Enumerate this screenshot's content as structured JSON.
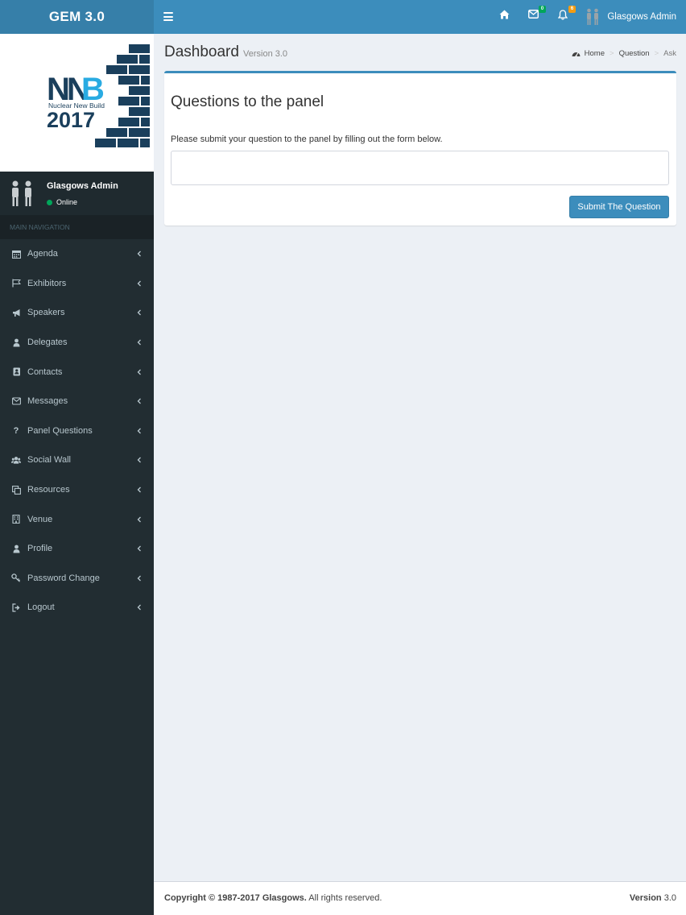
{
  "header": {
    "brand": "GEM 3.0",
    "messages_count": "0",
    "notifications_count": "6",
    "user_name": "Glasgows Admin"
  },
  "sidebar": {
    "logo_text_top": "NNB",
    "logo_tagline": "Nuclear New Build",
    "logo_year": "2017",
    "user_name": "Glasgows Admin",
    "user_status": "Online",
    "nav_header": "MAIN NAVIGATION",
    "items": [
      {
        "label": "Agenda",
        "icon": "calendar-icon"
      },
      {
        "label": "Exhibitors",
        "icon": "flag-icon"
      },
      {
        "label": "Speakers",
        "icon": "bullhorn-icon"
      },
      {
        "label": "Delegates",
        "icon": "user-icon"
      },
      {
        "label": "Contacts",
        "icon": "address-book-icon"
      },
      {
        "label": "Messages",
        "icon": "envelope-icon"
      },
      {
        "label": "Panel Questions",
        "icon": "question-icon"
      },
      {
        "label": "Social Wall",
        "icon": "users-icon"
      },
      {
        "label": "Resources",
        "icon": "clone-icon"
      },
      {
        "label": "Venue",
        "icon": "building-icon"
      },
      {
        "label": "Profile",
        "icon": "user-icon"
      },
      {
        "label": "Password Change",
        "icon": "key-icon"
      },
      {
        "label": "Logout",
        "icon": "sign-out-icon"
      }
    ]
  },
  "content_header": {
    "title": "Dashboard",
    "subtitle": "Version 3.0",
    "breadcrumb": [
      "Home",
      "Question",
      "Ask"
    ]
  },
  "box": {
    "title": "Questions to the panel",
    "description": "Please submit your question to the panel by filling out the form below.",
    "input_value": "",
    "submit_label": "Submit The Question"
  },
  "footer": {
    "copyright_bold": "Copyright © 1987-2017 Glasgows.",
    "copyright_rest": " All rights reserved.",
    "version_label": "Version",
    "version_value": " 3.0"
  },
  "colors": {
    "primary": "#3c8dbc",
    "brand_bg": "#367fa9",
    "sidebar_bg": "#222d32",
    "content_bg": "#ecf0f5",
    "online": "#00a65a",
    "notification_badge": "#f39c12",
    "logo_navy": "#1a3f5c",
    "logo_cyan": "#29abe2"
  }
}
